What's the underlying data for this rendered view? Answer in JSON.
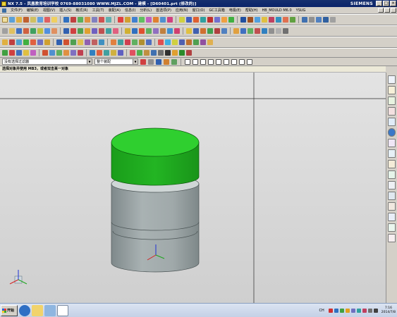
{
  "window": {
    "title": "NX 7.5 - 凤凰教育培训学校 0769-88031080 WWW.MJZL.COM - 建模 - [D60401.prt (修改的)]",
    "brand": "SIEMENS",
    "buttons": [
      "_",
      "□",
      "×"
    ]
  },
  "menubar": {
    "items": [
      "文件(F)",
      "编辑(E)",
      "视图(V)",
      "插入(S)",
      "格式(R)",
      "工具(T)",
      "装配(A)",
      "信息(I)",
      "分析(L)",
      "首选项(P)",
      "应用(N)",
      "窗口(O)",
      "GC工具箱",
      "电极(E)",
      "帮助(H)",
      "HB_MOULD M6.0",
      "YSUG"
    ]
  },
  "selection_bar": {
    "filter": "没有选择过滤器",
    "scope": "整个装配"
  },
  "cue_line": {
    "text": "选择对象并使用 MB3，或者双击某一对象"
  },
  "taskbar": {
    "start_label": "开始",
    "ime": "CH",
    "time": "7:16",
    "date": "2014/7/8"
  },
  "colors": {
    "green_top": "#1fae1f",
    "grey_body": "#9aa4a6"
  }
}
